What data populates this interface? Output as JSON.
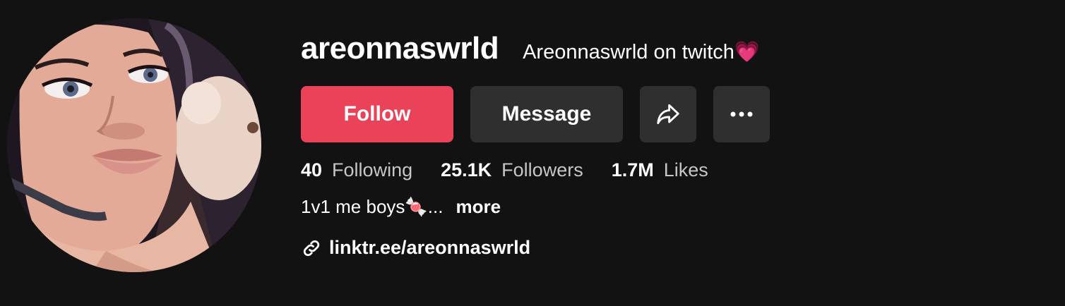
{
  "profile": {
    "username": "areonnaswrld",
    "nickname": "Areonnaswrld on twitch💗",
    "avatar_icon": "profile-photo"
  },
  "actions": {
    "follow_label": "Follow",
    "message_label": "Message",
    "share_icon": "share-arrow-icon",
    "more_icon": "more-dots-icon"
  },
  "stats": {
    "following_count": "40",
    "following_label": "Following",
    "followers_count": "25.1K",
    "followers_label": "Followers",
    "likes_count": "1.7M",
    "likes_label": "Likes"
  },
  "bio": {
    "text": "1v1 me boys🍬...",
    "more_label": "more"
  },
  "link": {
    "icon": "link-icon",
    "text": "linktr.ee/areonnaswrld"
  },
  "colors": {
    "background": "#121212",
    "follow_button": "#ea4359",
    "secondary_button": "#2f2f2f",
    "muted_text": "#c6c6c6"
  }
}
